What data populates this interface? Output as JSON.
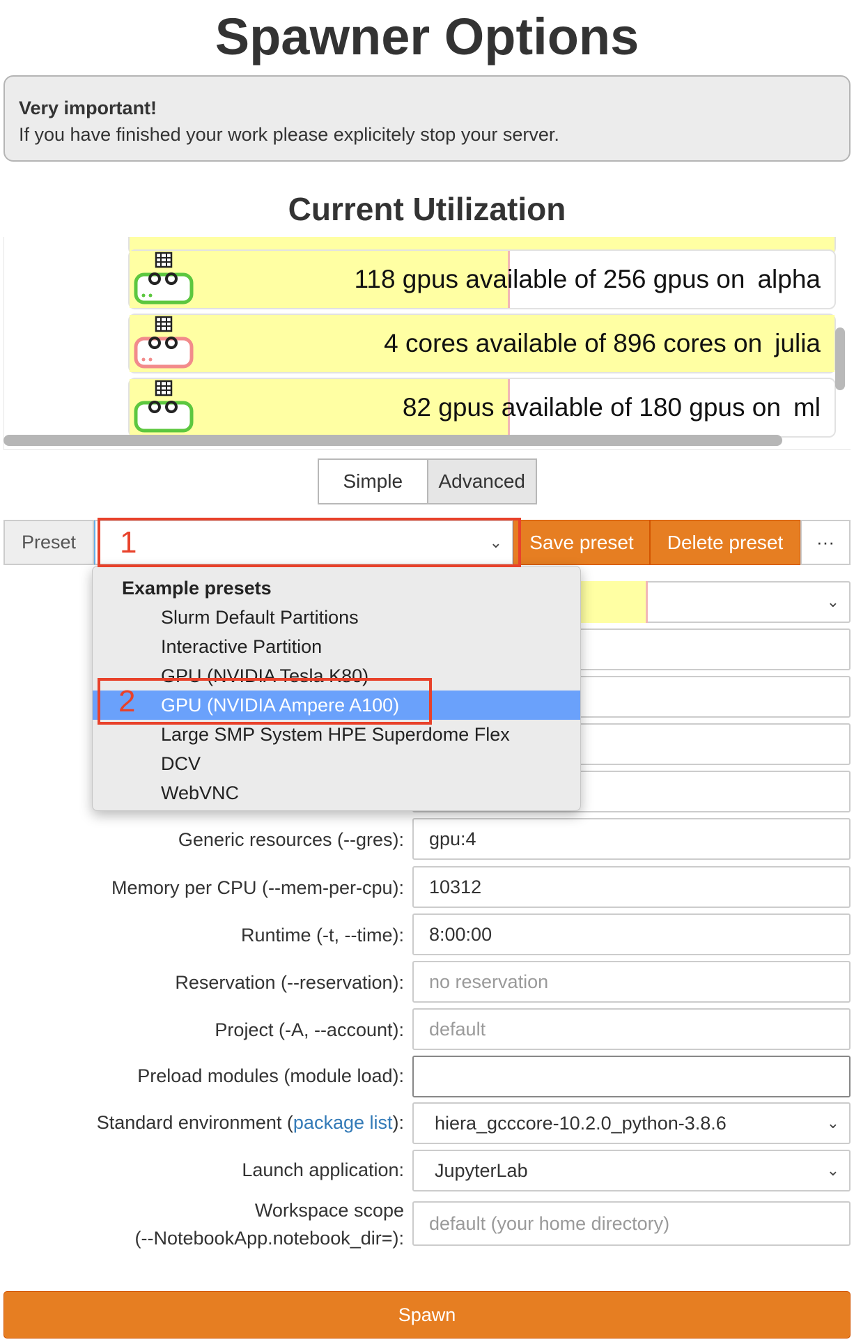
{
  "header": {
    "title": "Spawner Options"
  },
  "alert": {
    "title": "Very important!",
    "text": "If you have finished your work please explicitely stop your server."
  },
  "utilization": {
    "title": "Current Utilization",
    "rows": [
      {
        "text": "118 gpus available of 256 gpus on",
        "system": "alpha",
        "icon": "server-gpu-icon",
        "status_color": "#5cc73f",
        "fraction_used": 0.54
      },
      {
        "text": "4 cores available of 896 cores on",
        "system": "julia",
        "icon": "server-cpu-icon",
        "status_color": "#f28b8b",
        "fraction_used": 1.0
      },
      {
        "text": "82 gpus available of 180 gpus on",
        "system": "ml",
        "icon": "server-gpu-icon",
        "status_color": "#5cc73f",
        "fraction_used": 0.54
      }
    ]
  },
  "mode_toggle": {
    "simple": "Simple",
    "advanced": "Advanced",
    "active": "advanced"
  },
  "preset": {
    "label": "Preset",
    "save": "Save preset",
    "delete": "Delete preset",
    "more": "···",
    "annotation_1": "1",
    "annotation_2": "2",
    "dropdown": {
      "group": "Example presets",
      "items": [
        "Slurm Default Partitions",
        "Interactive Partition",
        "GPU (NVIDIA Tesla K80)",
        "GPU (NVIDIA Ampere A100)",
        "Large SMP System HPE Superdome Flex",
        "DCV",
        "WebVNC"
      ],
      "selected": "GPU (NVIDIA Ampere A100)"
    }
  },
  "form": {
    "gres": {
      "label": "Generic resources (--gres):",
      "value": "gpu:4"
    },
    "mem": {
      "label": "Memory per CPU (--mem-per-cpu):",
      "value": "10312"
    },
    "runtime": {
      "label": "Runtime (-t, --time):",
      "value": "8:00:00"
    },
    "reservation": {
      "label": "Reservation (--reservation):",
      "placeholder": "no reservation"
    },
    "project": {
      "label": "Project (-A, --account):",
      "placeholder": "default"
    },
    "modules": {
      "label": "Preload modules (module load):",
      "value": ""
    },
    "env": {
      "label_prefix": "Standard environment (",
      "link": "package list",
      "label_suffix": "):",
      "value": "hiera_gcccore-10.2.0_python-3.8.6"
    },
    "app": {
      "label": "Launch application:",
      "value": "JupyterLab"
    },
    "workspace": {
      "label_line1": "Workspace scope",
      "label_line2": "(--NotebookApp.notebook_dir=):",
      "placeholder": "default (your home directory)"
    }
  },
  "spawn": {
    "label": "Spawn"
  },
  "colors": {
    "accent_orange": "#e67e22",
    "highlight_blue": "#6aa1fb",
    "annotation_red": "#e8412a",
    "util_yellow": "#ffffa3"
  }
}
